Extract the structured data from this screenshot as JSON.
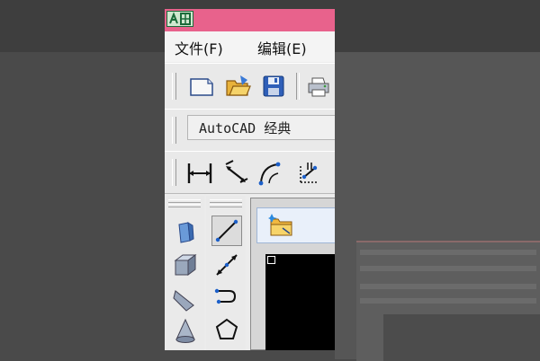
{
  "menu": {
    "file": "文件(F)",
    "edit": "编辑(E)"
  },
  "workspace": {
    "value": "AutoCAD 经典"
  },
  "colors": {
    "titlebar": "#e8628c",
    "canvas": "#000000",
    "accent_blue": "#1b5fc9"
  },
  "toolbar_icons": [
    "new-icon",
    "open-icon",
    "save-icon",
    "print-icon"
  ],
  "dimension_icons": [
    "linear-dimension-icon",
    "aligned-dimension-icon",
    "arc-length-dimension-icon",
    "ordinate-dimension-icon"
  ],
  "modeling_icons": [
    "polysolid-icon",
    "box-icon",
    "wedge-icon",
    "cone-icon"
  ],
  "draw_icons": [
    "line-icon",
    "construction-line-icon",
    "polyline-icon",
    "polygon-icon"
  ]
}
